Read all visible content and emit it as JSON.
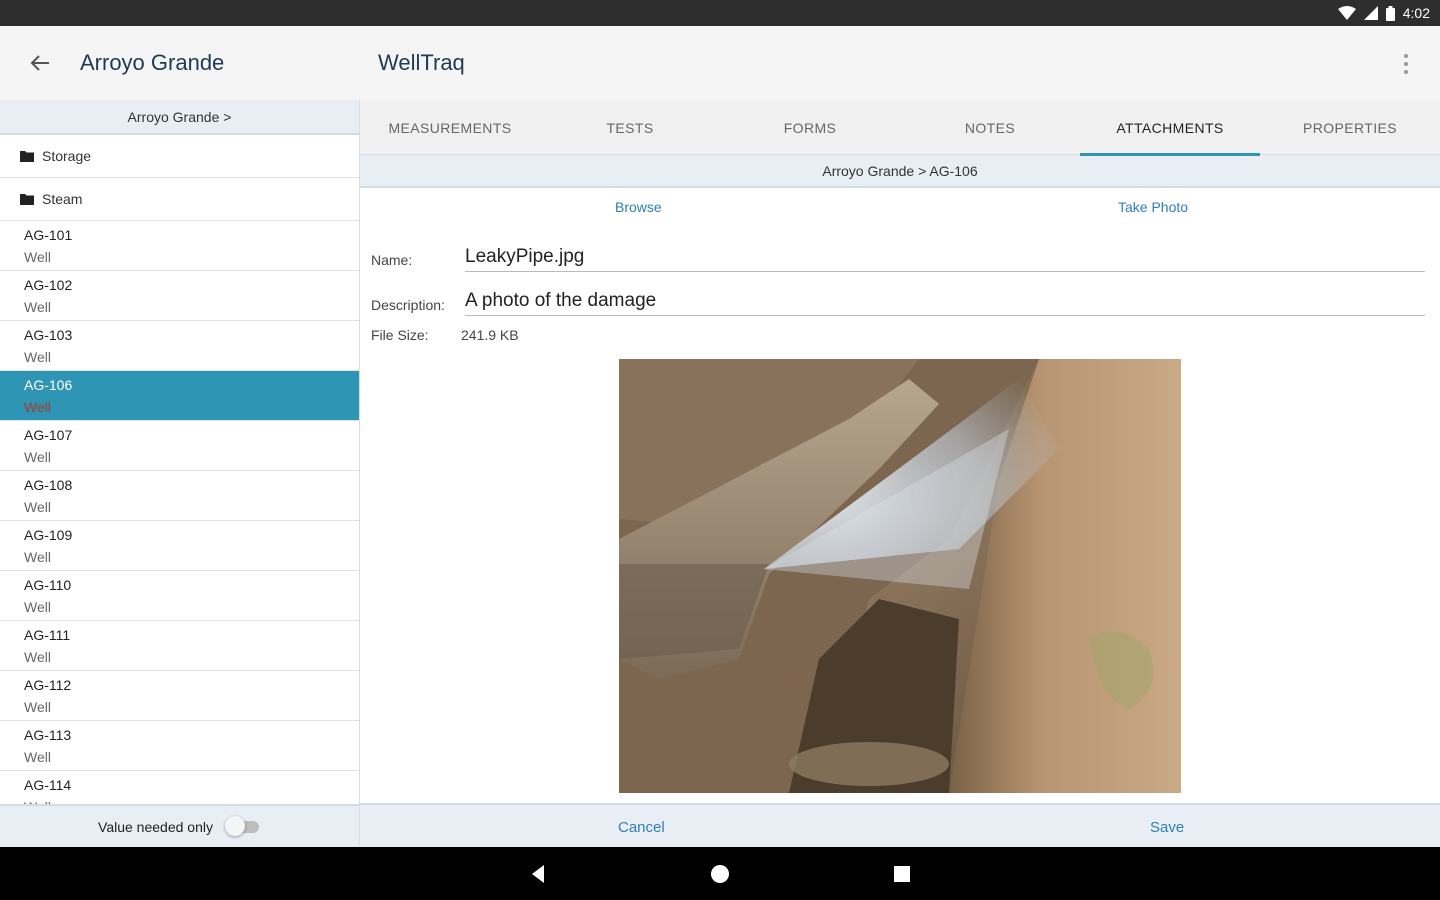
{
  "status_bar": {
    "time": "4:02"
  },
  "app_bar": {
    "title": "Arroyo Grande",
    "app_name": "WellTraq"
  },
  "left_pane": {
    "breadcrumb": "Arroyo Grande >",
    "folders": [
      {
        "label": "Storage"
      },
      {
        "label": "Steam"
      }
    ],
    "wells": [
      {
        "id": "AG-101",
        "type": "Well"
      },
      {
        "id": "AG-102",
        "type": "Well"
      },
      {
        "id": "AG-103",
        "type": "Well"
      },
      {
        "id": "AG-106",
        "type": "Well"
      },
      {
        "id": "AG-107",
        "type": "Well"
      },
      {
        "id": "AG-108",
        "type": "Well"
      },
      {
        "id": "AG-109",
        "type": "Well"
      },
      {
        "id": "AG-110",
        "type": "Well"
      },
      {
        "id": "AG-111",
        "type": "Well"
      },
      {
        "id": "AG-112",
        "type": "Well"
      },
      {
        "id": "AG-113",
        "type": "Well"
      },
      {
        "id": "AG-114",
        "type": "Well"
      }
    ],
    "selected_well": "AG-106",
    "footer_label": "Value needed only",
    "toggle_on": false
  },
  "tabs": [
    {
      "label": "MEASUREMENTS"
    },
    {
      "label": "TESTS"
    },
    {
      "label": "FORMS"
    },
    {
      "label": "NOTES"
    },
    {
      "label": "ATTACHMENTS"
    },
    {
      "label": "PROPERTIES"
    }
  ],
  "active_tab": "ATTACHMENTS",
  "attachment": {
    "breadcrumb": "Arroyo Grande > AG-106",
    "browse_label": "Browse",
    "take_photo_label": "Take Photo",
    "name_label": "Name:",
    "name_value": "LeakyPipe.jpg",
    "description_label": "Description:",
    "description_value": "A photo of the damage",
    "file_size_label": "File Size:",
    "file_size_value": "241.9 KB"
  },
  "footer": {
    "cancel_label": "Cancel",
    "save_label": "Save"
  },
  "colors": {
    "accent": "#2f95b4",
    "link": "#2f7fb8",
    "pane_header": "#e8eef3"
  }
}
